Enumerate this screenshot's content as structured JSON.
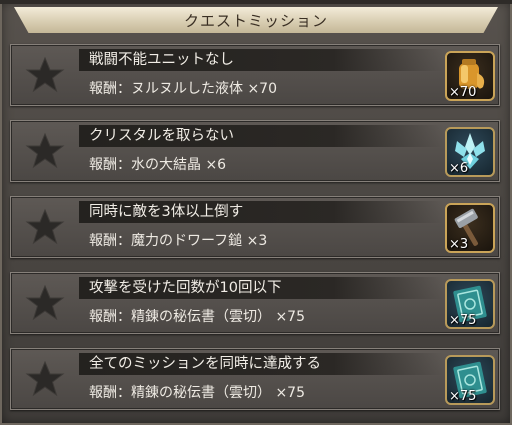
{
  "header": {
    "title": "クエストミッション"
  },
  "missions": [
    {
      "title": "戦闘不能ユニットなし",
      "reward": "報酬：ヌルヌルした液体 ×70",
      "qty": "×70",
      "icon": "slime-jar-icon"
    },
    {
      "title": "クリスタルを取らない",
      "reward": "報酬：水の大結晶 ×6",
      "qty": "×6",
      "icon": "water-crystal-icon"
    },
    {
      "title": "同時に敵を3体以上倒す",
      "reward": "報酬：魔力のドワーフ鎚 ×3",
      "qty": "×3",
      "icon": "dwarf-hammer-icon"
    },
    {
      "title": "攻撃を受けた回数が10回以下",
      "reward": "報酬：精錬の秘伝書（雲切） ×75",
      "qty": "×75",
      "icon": "secret-tome-icon"
    },
    {
      "title": "全てのミッションを同時に達成する",
      "reward": "報酬：精錬の秘伝書（雲切） ×75",
      "qty": "×75",
      "icon": "secret-tome-icon"
    }
  ],
  "colors": {
    "banner": "#e6dcc3",
    "panel": "#55504c",
    "star": "#2a2826"
  }
}
